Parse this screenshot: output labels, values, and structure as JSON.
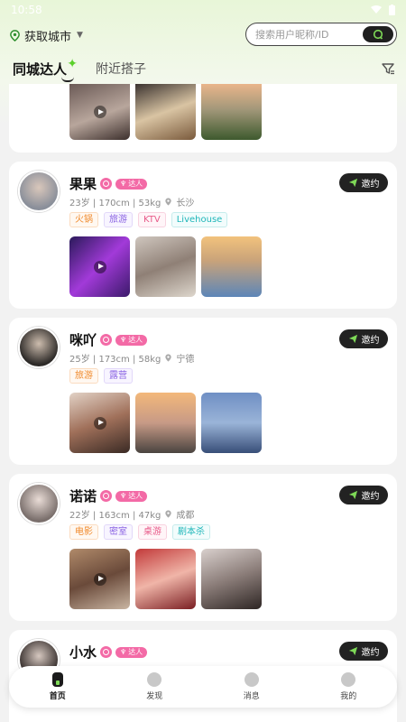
{
  "status": {
    "time": "10:58"
  },
  "location": {
    "label": "获取城市"
  },
  "search": {
    "placeholder": "搜索用户昵称/ID"
  },
  "tabs": [
    {
      "label": "同城达人"
    },
    {
      "label": "附近搭子"
    }
  ],
  "talent_badge": "达人",
  "invite_label": "邀约",
  "cards": [
    {
      "name": "果果",
      "info": "23岁 | 170cm | 53kg",
      "city": "长沙",
      "tags": [
        {
          "text": "火锅",
          "color": "orange"
        },
        {
          "text": "旅游",
          "color": "purple"
        },
        {
          "text": "KTV",
          "color": "pink"
        },
        {
          "text": "Livehouse",
          "color": "teal"
        }
      ]
    },
    {
      "name": "咪吖",
      "info": "25岁 | 173cm | 58kg",
      "city": "宁德",
      "tags": [
        {
          "text": "旅游",
          "color": "orange"
        },
        {
          "text": "露营",
          "color": "purple"
        }
      ]
    },
    {
      "name": "诺诺",
      "info": "22岁 | 163cm | 47kg",
      "city": "成都",
      "tags": [
        {
          "text": "电影",
          "color": "orange"
        },
        {
          "text": "密室",
          "color": "purple"
        },
        {
          "text": "桌游",
          "color": "pink"
        },
        {
          "text": "剧本杀",
          "color": "teal"
        }
      ]
    },
    {
      "name": "小水"
    }
  ],
  "nav": [
    {
      "label": "首页"
    },
    {
      "label": "发现"
    },
    {
      "label": "消息"
    },
    {
      "label": "我的"
    }
  ],
  "colors": {
    "accent_green": "#7ed957",
    "talent_pink": "#f36aa6",
    "invite_bg": "#222222"
  }
}
